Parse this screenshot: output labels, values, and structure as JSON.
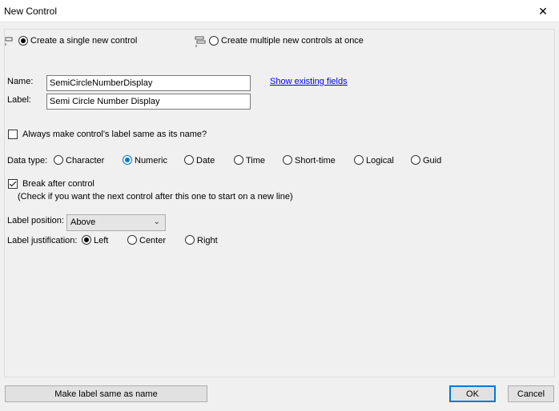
{
  "window": {
    "title": "New Control",
    "close_glyph": "✕"
  },
  "mode": {
    "single_label": "Create a single new control",
    "multiple_label": "Create multiple new controls at once",
    "selected": "single"
  },
  "fields": {
    "name_label": "Name:",
    "name_value": "SemiCircleNumberDisplay",
    "label_label": "Label:",
    "label_value": "Semi Circle Number Display",
    "show_existing_link": "Show existing fields"
  },
  "always_same": {
    "label": "Always make control's label same as its name?",
    "checked": false
  },
  "data_type": {
    "label": "Data type:",
    "options": [
      "Character",
      "Numeric",
      "Date",
      "Time",
      "Short-time",
      "Logical",
      "Guid"
    ],
    "selected": "Numeric"
  },
  "break_after": {
    "label": "Break after control",
    "hint": "(Check if you want the next control after this one to start on a new line)",
    "checked": true
  },
  "label_position": {
    "label": "Label position:",
    "value": "Above"
  },
  "label_justification": {
    "label": "Label justification:",
    "options": [
      "Left",
      "Center",
      "Right"
    ],
    "selected": "Left"
  },
  "footer": {
    "make_label_button": "Make label same as name",
    "ok_button": "OK",
    "cancel_button": "Cancel"
  },
  "colors": {
    "accent": "#0078d7",
    "link": "#0000ee",
    "background": "#f0f0f0"
  }
}
